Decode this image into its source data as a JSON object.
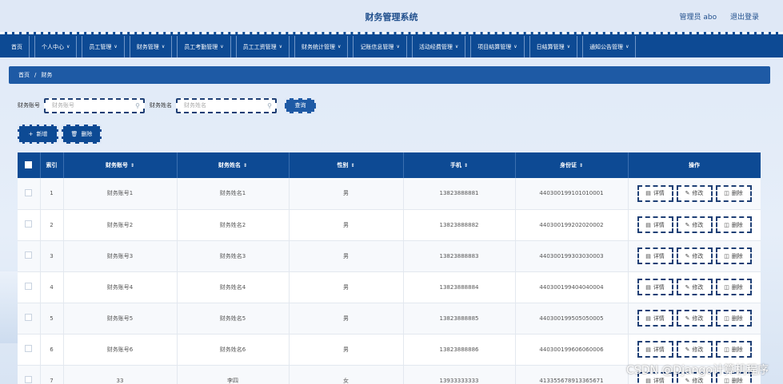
{
  "header": {
    "title": "财务管理系统",
    "user": "管理员 abo",
    "logout": "退出登录"
  },
  "nav": [
    {
      "label": "首页",
      "chevron": false
    },
    {
      "label": "个人中心",
      "chevron": true
    },
    {
      "label": "员工管理",
      "chevron": true
    },
    {
      "label": "财务管理",
      "chevron": true
    },
    {
      "label": "员工考勤管理",
      "chevron": true
    },
    {
      "label": "员工工资管理",
      "chevron": true
    },
    {
      "label": "财务统计管理",
      "chevron": true
    },
    {
      "label": "记账信息管理",
      "chevron": true
    },
    {
      "label": "活动经费管理",
      "chevron": true
    },
    {
      "label": "项目结算管理",
      "chevron": true
    },
    {
      "label": "日结算管理",
      "chevron": true
    },
    {
      "label": "通知公告管理",
      "chevron": true
    }
  ],
  "breadcrumb": {
    "home": "首页",
    "separator": "/",
    "current": "财务"
  },
  "search": {
    "account_label": "财务账号",
    "account_placeholder": "财务账号",
    "name_label": "财务姓名",
    "name_placeholder": "财务姓名",
    "query_button": "查询"
  },
  "actions": {
    "add": "新增",
    "delete": "删除"
  },
  "table": {
    "headers": [
      "索引",
      "财务账号",
      "财务姓名",
      "性别",
      "手机",
      "身份证",
      "操作"
    ],
    "operations": {
      "detail": "详情",
      "edit": "修改",
      "delete": "删除"
    },
    "rows": [
      {
        "index": "1",
        "account": "财务账号1",
        "name": "财务姓名1",
        "gender": "男",
        "phone": "13823888881",
        "id_card": "440300199101010001"
      },
      {
        "index": "2",
        "account": "财务账号2",
        "name": "财务姓名2",
        "gender": "男",
        "phone": "13823888882",
        "id_card": "440300199202020002"
      },
      {
        "index": "3",
        "account": "财务账号3",
        "name": "财务姓名3",
        "gender": "男",
        "phone": "13823888883",
        "id_card": "440300199303030003"
      },
      {
        "index": "4",
        "account": "财务账号4",
        "name": "财务姓名4",
        "gender": "男",
        "phone": "13823888884",
        "id_card": "440300199404040004"
      },
      {
        "index": "5",
        "account": "财务账号5",
        "name": "财务姓名5",
        "gender": "男",
        "phone": "13823888885",
        "id_card": "440300199505050005"
      },
      {
        "index": "6",
        "account": "财务账号6",
        "name": "财务姓名6",
        "gender": "男",
        "phone": "13823888886",
        "id_card": "440300199606060006"
      },
      {
        "index": "7",
        "account": "33",
        "name": "李四",
        "gender": "女",
        "phone": "13933333333",
        "id_card": "413355678913365671"
      }
    ]
  },
  "watermark": "CSDN @Django计算机程序"
}
